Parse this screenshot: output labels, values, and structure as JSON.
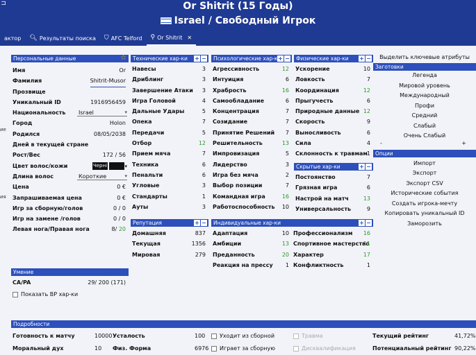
{
  "window": {
    "title": "Or Shitrit (15 Годы)",
    "subtitle": "Israel / Свободный Игрок"
  },
  "tabs": [
    {
      "label": "актор",
      "icon": ""
    },
    {
      "label": "Результаты поиска",
      "icon": "search-icon"
    },
    {
      "label": "AFC Telford",
      "icon": "shield-icon"
    },
    {
      "label": "Or Shitrit",
      "icon": "player-icon"
    }
  ],
  "personal": {
    "header": "Персональные данные",
    "name_label": "Имя",
    "name_value": "Or",
    "surname_label": "Фамилия",
    "surname_value": "Shitrit-Musor",
    "nickname_label": "Прозвище",
    "uid_label": "Уникальный ID",
    "uid_value": "1916956459",
    "nation_label": "Национальность",
    "nation_value": "Israel",
    "city_label": "Город",
    "city_value": "Holon",
    "born_label": "Родился",
    "born_value": "08/05/2038",
    "days_label": "Дней в текущей стране",
    "height_label": "Рост/Вес",
    "height_value": "172",
    "weight_value": "56",
    "hair_label": "Цвет волос/кожи",
    "hair_value": "Черні",
    "hairlen_label": "Длина волос",
    "hairlen_value": "Короткие",
    "price_label": "Цена",
    "price_value": "0 €",
    "wage_label": "Запрашиваемая цена",
    "wage_value": "0 €",
    "caps_label": "Игр за сборную/голов",
    "caps_value": "0 / 0",
    "subcaps_label": "Игр на замене /голов",
    "subcaps_value": "0 / 0",
    "foot_label": "Левая нога/Правая нога",
    "foot_left": "8/",
    "foot_right": "20"
  },
  "side_labels": [
    "ие",
    "ия"
  ],
  "ability": {
    "header": "Умение",
    "label": "CA/PA",
    "value": "29/ 200 (171)",
    "show_label": "Показать ВР хар-ки"
  },
  "technical": {
    "header": "Технические хар-ки",
    "items": [
      {
        "label": "Навесы",
        "value": "3"
      },
      {
        "label": "Дриблинг",
        "value": "3"
      },
      {
        "label": "Завершение Атаки",
        "value": "3"
      },
      {
        "label": "Игра Головой",
        "value": "4"
      },
      {
        "label": "Дальные Удары",
        "value": "5"
      },
      {
        "label": "Опека",
        "value": "7"
      },
      {
        "label": "Передачи",
        "value": "5"
      },
      {
        "label": "Отбор",
        "value": "12",
        "green": true
      },
      {
        "label": "Прием мяча",
        "value": "7"
      },
      {
        "label": "Техника",
        "value": "6"
      },
      {
        "label": "Пенальти",
        "value": "6"
      },
      {
        "label": "Угловые",
        "value": "3"
      },
      {
        "label": "Стандарты",
        "value": "1"
      },
      {
        "label": "Ауты",
        "value": "3"
      }
    ]
  },
  "mental": {
    "header": "Психологические хар-ки",
    "items": [
      {
        "label": "Агрессивность",
        "value": "12",
        "green": true
      },
      {
        "label": "Интуиция",
        "value": "6"
      },
      {
        "label": "Храбрость",
        "value": "16",
        "green": true
      },
      {
        "label": "Самообладание",
        "value": "6"
      },
      {
        "label": "Концентрация",
        "value": "7"
      },
      {
        "label": "Созидание",
        "value": "7"
      },
      {
        "label": "Принятие Решений",
        "value": "7"
      },
      {
        "label": "Решительность",
        "value": "13",
        "green": true
      },
      {
        "label": "Импровизация",
        "value": "5"
      },
      {
        "label": "Лидерство",
        "value": "3"
      },
      {
        "label": "Игра без мяча",
        "value": "2"
      },
      {
        "label": "Выбор позиции",
        "value": "7"
      },
      {
        "label": "Командная игра",
        "value": "16",
        "green": true
      },
      {
        "label": "Работоспособность",
        "value": "10"
      }
    ]
  },
  "physical": {
    "header": "Физические хар-ки",
    "items": [
      {
        "label": "Ускорение",
        "value": "10"
      },
      {
        "label": "Ловкость",
        "value": "7"
      },
      {
        "label": "Координация",
        "value": "12",
        "green": true
      },
      {
        "label": "Прыгучесть",
        "value": "6"
      },
      {
        "label": "Природные данные",
        "value": "12",
        "green": true
      },
      {
        "label": "Скорость",
        "value": "9"
      },
      {
        "label": "Выносливость",
        "value": "6"
      },
      {
        "label": "Сила",
        "value": "4"
      },
      {
        "label": "Склонность к травмам",
        "value": "1"
      }
    ]
  },
  "hidden": {
    "header": "Скрытые хар-ки",
    "items": [
      {
        "label": "Постоянство",
        "value": "7"
      },
      {
        "label": "Грязная игра",
        "value": "6"
      },
      {
        "label": "Настрой на матч",
        "value": "13",
        "green": true
      },
      {
        "label": "Универсальность",
        "value": "9"
      }
    ]
  },
  "reputation": {
    "header": "Репутация",
    "items": [
      {
        "label": "Домашняя",
        "value": "837"
      },
      {
        "label": "Текущая",
        "value": "1356"
      },
      {
        "label": "Мировая",
        "value": "279"
      }
    ]
  },
  "individual": {
    "header": "Индивидуальные хар-ки",
    "left": [
      {
        "label": "Адаптация",
        "value": "10"
      },
      {
        "label": "Амбиции",
        "value": "13",
        "green": true
      },
      {
        "label": "Преданность",
        "value": "20",
        "green": true
      },
      {
        "label": "Реакция на прессу",
        "value": "1"
      }
    ],
    "right": [
      {
        "label": "Профессионализм",
        "value": "16",
        "green": true
      },
      {
        "label": "Спортивное мастерство",
        "value": "11",
        "green": true
      },
      {
        "label": "Характер",
        "value": "17",
        "green": true
      },
      {
        "label": "Конфликтность",
        "value": "1"
      }
    ]
  },
  "right_panel": {
    "highlight_label": "Выделить ключевые атрибуты",
    "presets_header": "Заготовки",
    "presets": [
      "Легенда",
      "Мировой уровень",
      "Международный",
      "Профи",
      "Средний",
      "Слабый",
      "Очень Слабый"
    ],
    "slider_minus": "-",
    "slider_plus": "+",
    "options_header": "Опции",
    "options": [
      "Импорт",
      "Экспорт",
      "Экспорт CSV",
      "Исторические события",
      "Создать игрока-мечту",
      "Копировать уникальный ID",
      "Заморозить"
    ]
  },
  "details": {
    "header": "Подробности",
    "form_label": "Готовность к матчу",
    "form_value": "10000",
    "fatigue_label": "Усталость",
    "fatigue_value": "100",
    "morale_label": "Моральный дух",
    "morale_value": "10",
    "condition_label": "Физ. Форма",
    "condition_value": "6976",
    "retired_intl": "Уходит из сборной",
    "plays_intl": "Играет за сборную",
    "injury": "Травма",
    "ban": "Дисквалификация",
    "cur_rating_label": "Текущий рейтинг",
    "cur_rating_value": "41,72%",
    "pot_rating_label": "Потенциальный рейтинг",
    "pot_rating_value": "90,22%"
  },
  "colors": {
    "header_blue": "#2c4fbb",
    "title_blue": "#1f3a93",
    "background": "#f2f3f8",
    "green": "#2a9a2a",
    "star": "#f6c400"
  }
}
